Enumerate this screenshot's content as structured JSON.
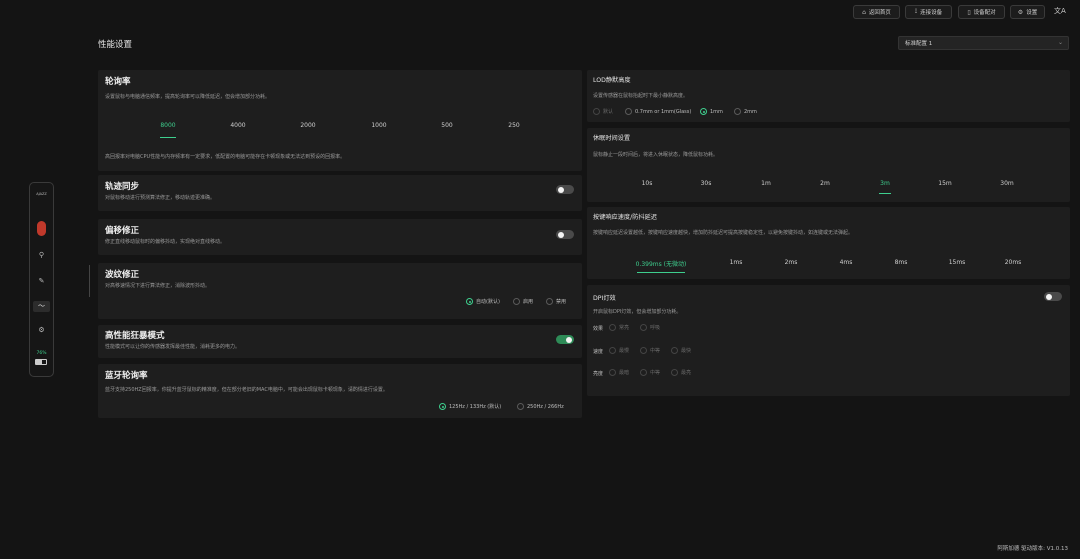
{
  "topbar": {
    "buttons": [
      {
        "label": "返回首页",
        "icon": "home-icon"
      },
      {
        "label": "连接设备",
        "icon": "signal-icon"
      },
      {
        "label": "设备配对",
        "icon": "mouse-icon"
      },
      {
        "label": "设置",
        "icon": "gear-icon"
      }
    ],
    "translate_icon": "文A"
  },
  "page": {
    "title": "性能设置",
    "profile_select": "标准配置 1"
  },
  "sidebar": {
    "brand": "AJAZZ",
    "battery": "76%",
    "items": [
      "mouse-icon",
      "key-icon",
      "tools-icon",
      "performance-icon",
      "gear-icon"
    ]
  },
  "polling": {
    "title": "轮询率",
    "desc": "设置鼠标与电脑通信频率，提高轮询率可以降低延迟，但会增加部分功耗。",
    "options": [
      "8000",
      "4000",
      "2000",
      "1000",
      "500",
      "250"
    ],
    "selected": "8000",
    "note": "高回报率对电脑CPU性能与内存频率有一定要求，低配置的电脑可能存在卡顿现象或无法达到预设的回报率。"
  },
  "track_sync": {
    "title": "轨迹同步",
    "desc": "对鼠标移动进行预测算法修正，移动轨迹更准确。",
    "enabled": false
  },
  "offset": {
    "title": "偏移修正",
    "desc": "修正直线移动鼠标时的偏移抖动，实现绝对直线移动。",
    "enabled": false
  },
  "ripple": {
    "title": "波纹修正",
    "desc": "对高移速情况下进行算法修正，消除波形抖动。",
    "options": [
      "自动(默认)",
      "启用",
      "禁用"
    ],
    "selected": "自动(默认)"
  },
  "frenzy": {
    "title": "高性能狂暴模式",
    "desc": "性能模式可以让你的传感器发挥最佳性能，消耗更多的电力。",
    "enabled": true
  },
  "bluetooth": {
    "title": "蓝牙轮询率",
    "desc": "蓝牙支持250HZ回报率，你提升蓝牙鼠标的精准度，但在部分老旧的MAC电脑中，可能会出现鼠标卡顿现象，请酌情进行设置。",
    "options": [
      "125Hz / 133Hz (默认)",
      "250Hz / 266Hz"
    ],
    "selected": "125Hz / 133Hz (默认)"
  },
  "lod": {
    "title": "LOD静默高度",
    "desc": "设置传感器在鼠标抬起时下最小静默高度。",
    "options": [
      "默认",
      "0.7mm or 1mm(Glass)",
      "1mm",
      "2mm"
    ],
    "selected": "1mm"
  },
  "sleep": {
    "title": "休眠时间设置",
    "desc": "鼠标静止一段时间后，将进入休眠状态，降低鼠标功耗。",
    "options": [
      "10s",
      "30s",
      "1m",
      "2m",
      "3m",
      "15m",
      "30m"
    ],
    "selected": "3m"
  },
  "debounce": {
    "title": "按键响应速度/防抖延迟",
    "desc": "按键响应延迟设置越低，按键响应速度越快，增加防抖延迟可提高按键稳定性，以避免按键抖动，如连键或无法弹起。",
    "options": [
      "0.399ms (无微动)",
      "1ms",
      "2ms",
      "4ms",
      "8ms",
      "15ms",
      "20ms"
    ],
    "selected": "0.399ms (无微动)"
  },
  "dpi_light": {
    "title": "DPI灯效",
    "desc": "开启鼠标DPI灯效，但会增加部分功耗。",
    "enabled": false,
    "effect": {
      "label": "效果",
      "options": [
        "常亮",
        "呼吸"
      ]
    },
    "speed": {
      "label": "速度",
      "options": [
        "最慢",
        "中等",
        "最快"
      ]
    },
    "brightness": {
      "label": "亮度",
      "options": [
        "最暗",
        "中等",
        "最亮"
      ]
    }
  },
  "footer": "阿斯加德 驱动版本: V1.0.13",
  "colors": {
    "accent": "#3ecf8e",
    "background": "#141414",
    "card": "#1e1e1e"
  }
}
